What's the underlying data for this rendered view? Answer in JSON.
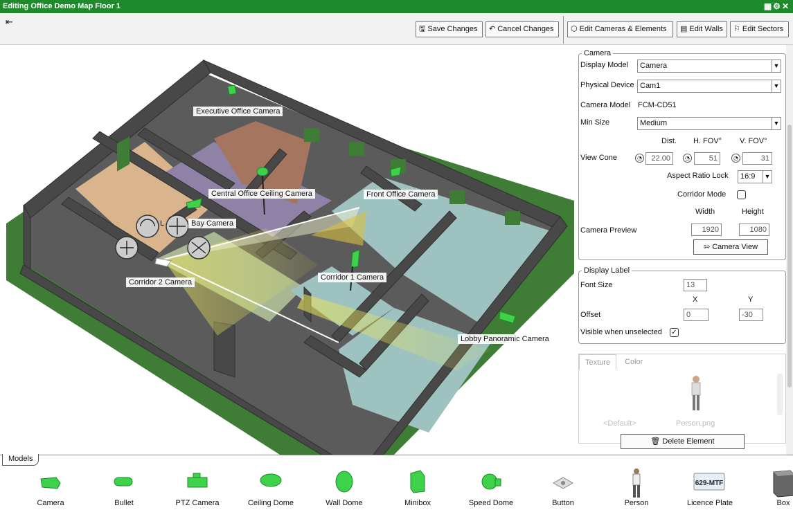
{
  "window": {
    "title": "Editing Office Demo Map Floor 1"
  },
  "toolbar": {
    "save": "Save Changes",
    "cancel": "Cancel Changes",
    "edit_cameras": "Edit Cameras & Elements",
    "edit_walls": "Edit Walls",
    "edit_sectors": "Edit Sectors"
  },
  "viewport_labels": {
    "executive": "Executive Office Camera",
    "central": "Central Office Ceiling Camera",
    "front": "Front Office Camera",
    "bay": "Bay Camera",
    "bay_prefix": "L",
    "corridor2": "Corridor 2 Camera",
    "corridor1": "Corridor 1 Camera",
    "lobby": "Lobby Panoramic Camera"
  },
  "camera": {
    "legend": "Camera",
    "display_model_label": "Display Model",
    "display_model_value": "Camera",
    "physical_device_label": "Physical Device",
    "physical_device_value": "Cam1",
    "camera_model_label": "Camera Model",
    "camera_model_value": "FCM-CD51",
    "min_size_label": "Min Size",
    "min_size_value": "Medium",
    "dist_header": "Dist.",
    "hfov_header": "H. FOV°",
    "vfov_header": "V. FOV°",
    "view_cone_label": "View Cone",
    "dist_value": "22.00",
    "hfov_value": "51",
    "vfov_value": "31",
    "aspect_label": "Aspect Ratio Lock",
    "aspect_value": "16:9",
    "corridor_label": "Corridor Mode",
    "width_header": "Width",
    "height_header": "Height",
    "preview_label": "Camera Preview",
    "preview_width": "1920",
    "preview_height": "1080",
    "camera_view_button": "Camera View"
  },
  "display_label": {
    "legend": "Display Label",
    "font_size_label": "Font Size",
    "font_size_value": "13",
    "x_header": "X",
    "y_header": "Y",
    "offset_label": "Offset",
    "offset_x": "0",
    "offset_y": "-30",
    "visible_label": "Visible when unselected"
  },
  "texture": {
    "tab_texture": "Texture",
    "tab_color": "Color",
    "default_label": "<Default>",
    "person_label": "Person.png"
  },
  "delete_button": "Delete Element",
  "models": {
    "tab": "Models",
    "items": [
      "Camera",
      "Bullet",
      "PTZ Camera",
      "Ceiling Dome",
      "Wall Dome",
      "Minibox",
      "Speed Dome",
      "Button",
      "Person",
      "Licence Plate",
      "Box"
    ],
    "plate_text": "629-MTF"
  },
  "colors": {
    "title_green": "#1f8a2b",
    "model_green": "#3ed14a",
    "wall_gray": "#4a4a4a",
    "ground_green": "#3f7d36"
  }
}
